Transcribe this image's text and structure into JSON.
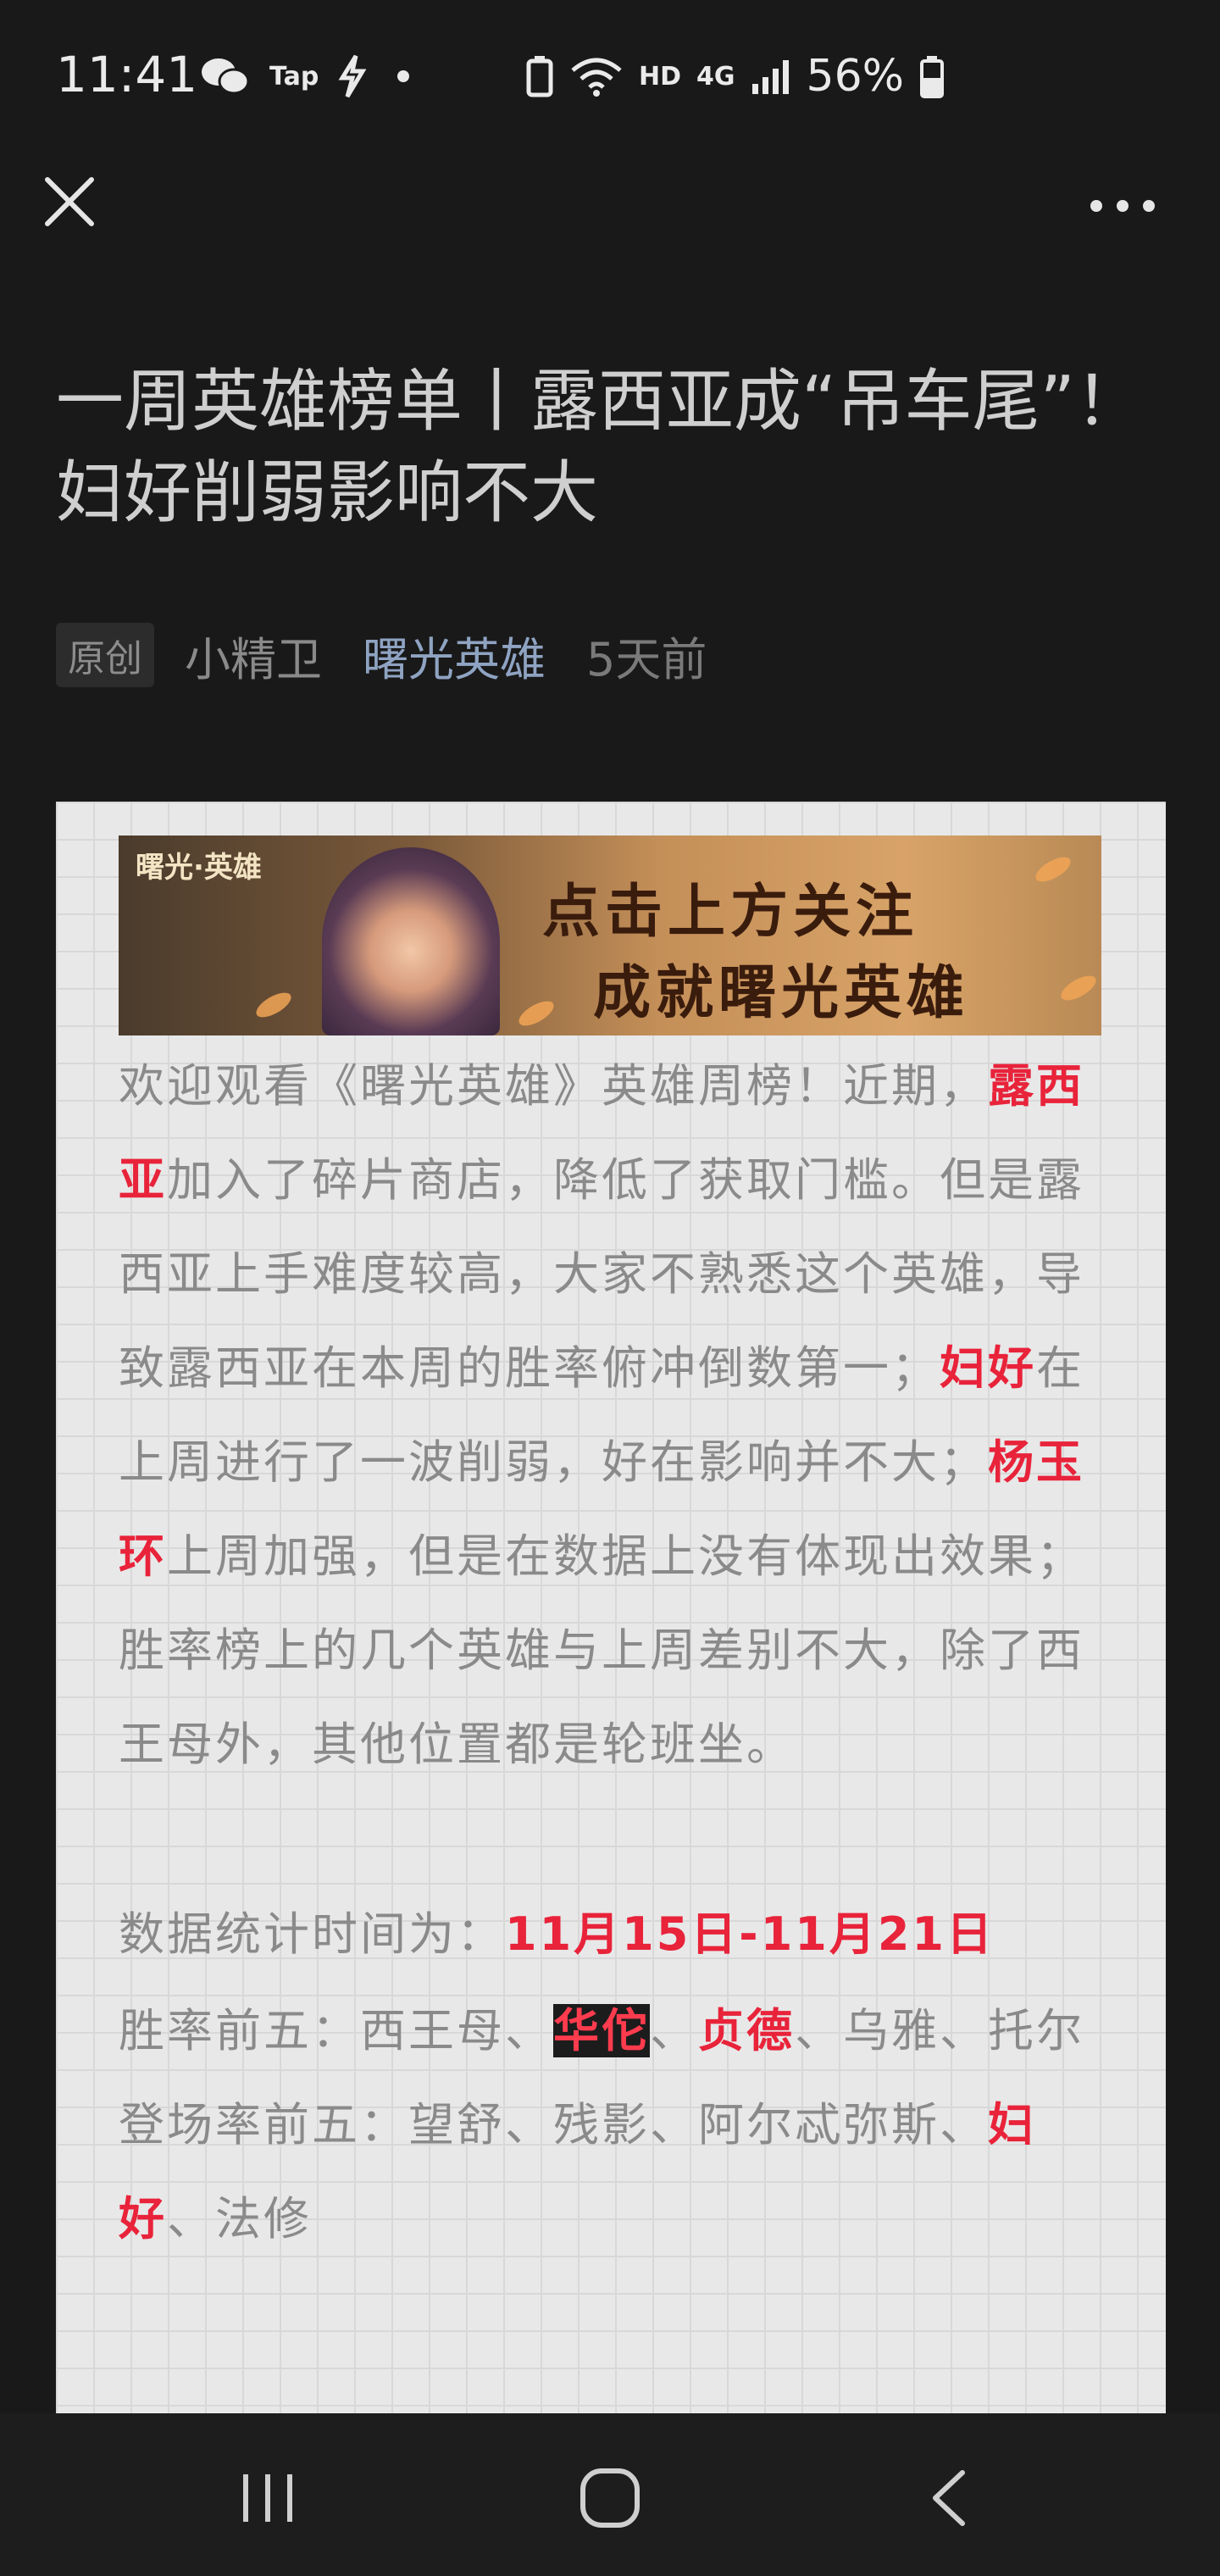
{
  "status_bar": {
    "time": "11:41",
    "tap_label": "Tap",
    "hd_label": "HD",
    "network_label": "4G",
    "battery": "56%"
  },
  "article": {
    "title": "一周英雄榜单丨露西亚成“吊车尾”！妇好削弱影响不大",
    "badge": "原创",
    "author": "小精卫",
    "account": "曙光英雄",
    "time": "5天前"
  },
  "banner": {
    "logo": "曙光·英雄",
    "line1": "点击上方关注",
    "line2": "成就曙光英雄"
  },
  "body": {
    "p1_a": "欢迎观看《曙光英雄》英雄周榜！近期，",
    "p1_hl1": "露西亚",
    "p1_b": "加入了碎片商店，降低了获取门槛。但是露西亚上手难度较高，大家不熟悉这个英雄，导致露西亚在本周的胜率俯冲倒数第一；",
    "p1_hl2": "妇好",
    "p1_c": "在上周进行了一波削弱，好在影响并不大；",
    "p1_hl3": "杨玉环",
    "p1_d": "上周加强，但是在数据上没有体现出效果；胜率榜上的几个英雄与上周差别不大，除了西王母外，其他位置都是轮班坐。",
    "stat_time_label": "数据统计时间为：",
    "stat_time_value": "11月15日-11月21日",
    "winrate_label": "胜率前五：西王母、",
    "winrate_hl1": "华佗",
    "winrate_sep": "、",
    "winrate_hl2": "贞德",
    "winrate_rest": "、乌雅、托尔",
    "appear_label": "登场率前五：望舒、残影、阿尔忒弥斯、",
    "appear_hl": "妇好",
    "appear_rest": "、法修"
  }
}
